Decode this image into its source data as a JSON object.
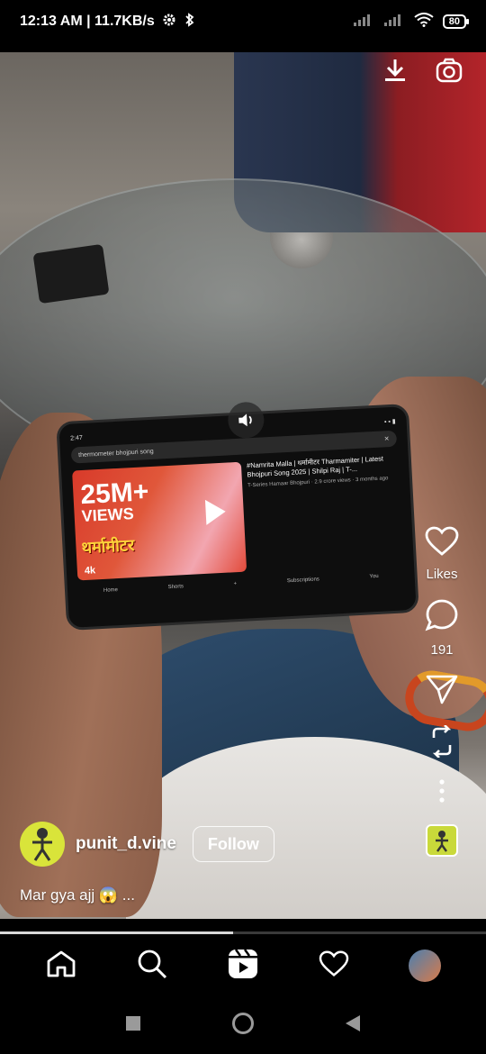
{
  "status_bar": {
    "time_and_speed": "12:13 AM | 11.7KB/s",
    "battery": "80"
  },
  "embedded_phone": {
    "status_time": "2:47",
    "search_query": "thermometer bhojpuri song",
    "views_big": "25M+",
    "views_small": "VIEWS",
    "thumbnail_title": "थर्मामीटर",
    "quality_badge": "4k",
    "video_title": "#Namrita Malla | थर्मामीटर Tharmamiter | Latest Bhojpuri Song 2025 | Shilpi Raj | T-...",
    "video_meta": "T-Series Hamaar Bhojpuri · 2.9 crore views · 3 months ago",
    "nav": [
      "Home",
      "Shorts",
      "+",
      "Subscriptions",
      "You"
    ]
  },
  "overlay": {
    "download_icon": "download-icon",
    "camera_icon": "camera-icon"
  },
  "actions": {
    "likes_label": "Likes",
    "comments_count": "191"
  },
  "author": {
    "username": "punit_d.vine",
    "follow_label": "Follow"
  },
  "caption": "Mar gya ajj 😱 ...",
  "progress_fraction": 0.48,
  "bottom_nav": [
    "home-icon",
    "search-icon",
    "reels-icon",
    "heart-icon",
    "profile-avatar"
  ],
  "colors": {
    "background": "#000000",
    "text": "#ffffff",
    "progress": "#d8d8d8"
  }
}
